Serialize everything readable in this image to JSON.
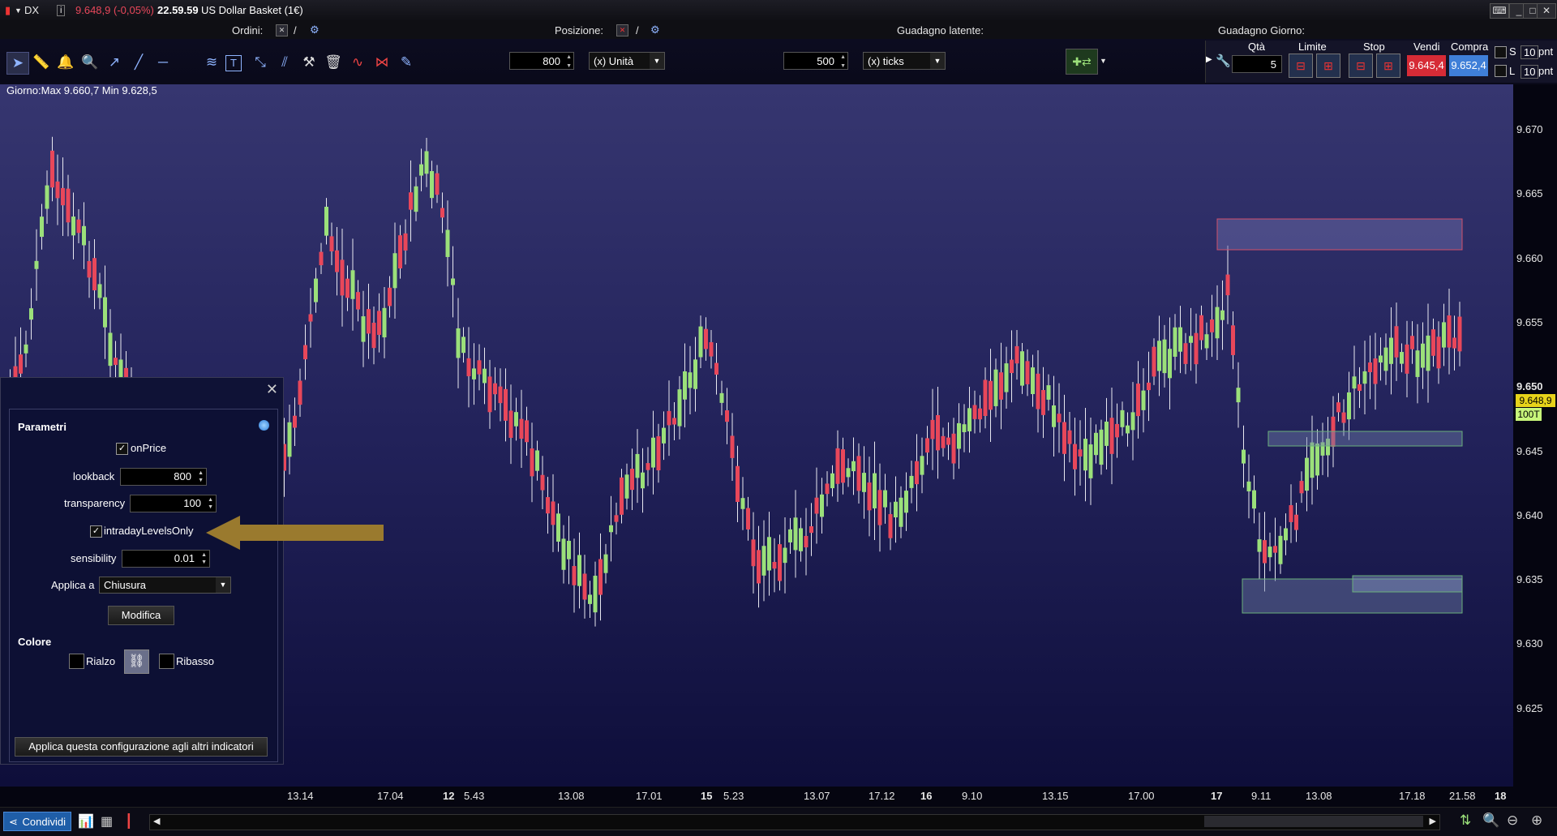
{
  "title_bar": {
    "symbol": "DX",
    "price_change": "9.648,9 (-0,05%)",
    "time": "22.59.59",
    "instrument": "US Dollar Basket (1€)"
  },
  "summary_row": {
    "orders_label": "Ordini:",
    "position_label": "Posizione:",
    "latent_gain_label": "Guadagno latente:",
    "day_gain_label": "Guadagno Giorno:",
    "slash": "/"
  },
  "toolbar": {
    "units_value": "800",
    "units_combo": "(x) Unità",
    "ticks_value": "500",
    "ticks_combo": "(x) ticks"
  },
  "trade_panel": {
    "qty_label": "Qtà",
    "qty_value": "5",
    "limit_label": "Limite",
    "stop_label": "Stop",
    "sell_label": "Vendi",
    "sell_price": "9.645,4",
    "buy_label": "Compra",
    "buy_price": "9.652,4",
    "s_label": "S",
    "s_value": "10",
    "l_label": "L",
    "l_value": "10",
    "pnt_label": "pnt"
  },
  "chart_info": "Giorno:Max 9.660,7 Min 9.628,5",
  "price_axis": [
    "9.670",
    "9.665",
    "9.660",
    "9.655",
    "9.650",
    "9.645",
    "9.640",
    "9.635",
    "9.630",
    "9.625"
  ],
  "price_tags": {
    "last": "9.648,9",
    "ticks": "100T"
  },
  "time_axis": [
    {
      "label": "13.14",
      "bold": false
    },
    {
      "label": "17.04",
      "bold": false
    },
    {
      "label": "12",
      "bold": true
    },
    {
      "label": "5.43",
      "bold": false
    },
    {
      "label": "13.08",
      "bold": false
    },
    {
      "label": "17.01",
      "bold": false
    },
    {
      "label": "15",
      "bold": true
    },
    {
      "label": "5.23",
      "bold": false
    },
    {
      "label": "13.07",
      "bold": false
    },
    {
      "label": "17.12",
      "bold": false
    },
    {
      "label": "16",
      "bold": true
    },
    {
      "label": "9.10",
      "bold": false
    },
    {
      "label": "13.15",
      "bold": false
    },
    {
      "label": "17.00",
      "bold": false
    },
    {
      "label": "17",
      "bold": true
    },
    {
      "label": "9.11",
      "bold": false
    },
    {
      "label": "13.08",
      "bold": false
    },
    {
      "label": "17.18",
      "bold": false
    },
    {
      "label": "21.58",
      "bold": false
    },
    {
      "label": "18",
      "bold": true
    }
  ],
  "params_panel": {
    "title": "Parametri",
    "on_price_label": "onPrice",
    "lookback_label": "lookback",
    "lookback_value": "800",
    "transparency_label": "transparency",
    "transparency_value": "100",
    "intraday_label": "intradayLevelsOnly",
    "sensibility_label": "sensibility",
    "sensibility_value": "0.01",
    "apply_to_label": "Applica a",
    "apply_to_value": "Chiusura",
    "modify_button": "Modifica",
    "color_label": "Colore",
    "rise_label": "Rialzo",
    "fall_label": "Ribasso",
    "apply_all_button": "Applica questa configurazione agli altri indicatori",
    "checkmark": "✓"
  },
  "status_bar": {
    "share_label": "Condividi"
  },
  "colors": {
    "bull": "#9be07a",
    "bear": "#e8475a",
    "sell_button": "#d62b36",
    "buy_button": "#3f7fd8",
    "last_price_tag": "#e7d31a",
    "ticks_tag": "#c7f57a",
    "arrow": "#9a7a2e"
  }
}
